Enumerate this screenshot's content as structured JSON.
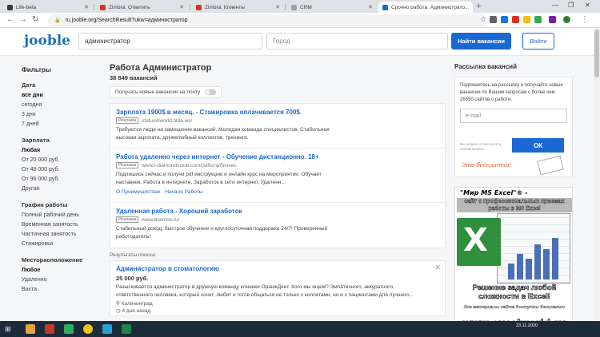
{
  "browser": {
    "tabs": [
      {
        "label": "Life-beta",
        "color": "#3a3a3a"
      },
      {
        "label": "Zimbra: Ответить",
        "color": "#d93025"
      },
      {
        "label": "Zimbra: Клиенты",
        "color": "#d93025"
      },
      {
        "label": "CRM",
        "color": "#9aa0a6"
      },
      {
        "label": "Срочно работа: Администрато...",
        "color": "#1a68d1",
        "active": true
      }
    ],
    "url": "ru.jooble.org/SearchResult?ukw=администратор"
  },
  "header": {
    "logo": "jooble",
    "search_value": "администратор",
    "city_placeholder": "Город",
    "find_button": "Найти вакансии",
    "login_button": "Войти"
  },
  "filters": {
    "title": "Фильтры",
    "groups": [
      {
        "title": "Дата",
        "items": [
          "все дни",
          "сегодня",
          "3 дня",
          "7 дней"
        ],
        "selected": 0
      },
      {
        "title": "Зарплата",
        "items": [
          "Любая",
          "От 20 000 руб.",
          "От 48 000 руб.",
          "От 96 000 руб.",
          "Другая"
        ],
        "selected": 0
      },
      {
        "title": "График работы",
        "items": [
          "Полный рабочий день",
          "Временная занятость",
          "Частичная занятость",
          "Стажировка"
        ],
        "selected": -1
      },
      {
        "title": "Месторасположение",
        "items": [
          "Любое",
          "Удаленно",
          "Вахта"
        ],
        "selected": 0
      }
    ]
  },
  "main": {
    "title": "Работа Администратор",
    "count": "38 849 вакансий",
    "subscribe_label": "Получать новые вакансии на почту",
    "ads": [
      {
        "title": "Зарплата 1900$ в месяц. - Стажировка оплачивается 700$.",
        "tag": "Реклама",
        "url": "statusinworld.tilda.ws/",
        "desc1": "Требуются люди на замещение вакансий. Молодая команда специалистов. Стабильная",
        "desc2": "высокая зарплата, дружелюбный коллектив, тренинги.",
        "links": ""
      },
      {
        "title": "Работа удаленно через интернет - Обучение дистанционно. 18+",
        "tag": "Реклама",
        "url": "www.i-diamondsclub.com/работа/бизнес",
        "desc1": "Подпишись сейчас и получи pdf инструкцию и онлайн курс на мероприятии. Обучает",
        "desc2": "наставник. Работа в интернете. Заработок в сети интернет. Удаленн...",
        "links": "О Преимуществах · Начало Работы"
      },
      {
        "title": "Удаленная работа - Хороший заработок",
        "tag": "Реклама",
        "url": "www.bownce.ru/",
        "desc1": "Стабильный доход, быстрое обучение и круглосуточная поддержка 24/7! Проверенный",
        "desc2": "работодатель!",
        "links": ""
      }
    ],
    "results_label": "Результаты поиска:",
    "vacancy": {
      "title": "Администратор в стоматологию",
      "salary": "25 000 руб.",
      "desc1": "Разыскивается администратор в дружную команду клиники ОранжДент. Кого мы ищем? Эмпатичного, аккуратного,",
      "desc2": "ответственного человека, который хочет, любит и готов общаться не только с коллегами, но и с пациентами для лучшего...",
      "location": "Калининград",
      "time": "4 дня назад"
    }
  },
  "sidebar": {
    "title": "Рассылка вакансий",
    "text": "Подпишитесь на рассылку и получайте новые вакансии по Вашим запросам с более чем 26550 сайтов о работе.",
    "email_placeholder": "e-mail",
    "ok_button": "ОК",
    "note": "Вы можете отписаться в любой момент",
    "free": "Это бесплатно!",
    "banner": {
      "line1": "\"Мир MS Excel\"®  -",
      "line2": "сайт о профессиональных приемах работы в MS Excel",
      "line3": "Решение задач любой сложности в Excel!",
      "line4": "Все материалы сайта доступны бесплатно"
    },
    "watermark": "www.excelworld.ru"
  },
  "taskbar": {
    "time": "",
    "date": "23.11.2020"
  }
}
